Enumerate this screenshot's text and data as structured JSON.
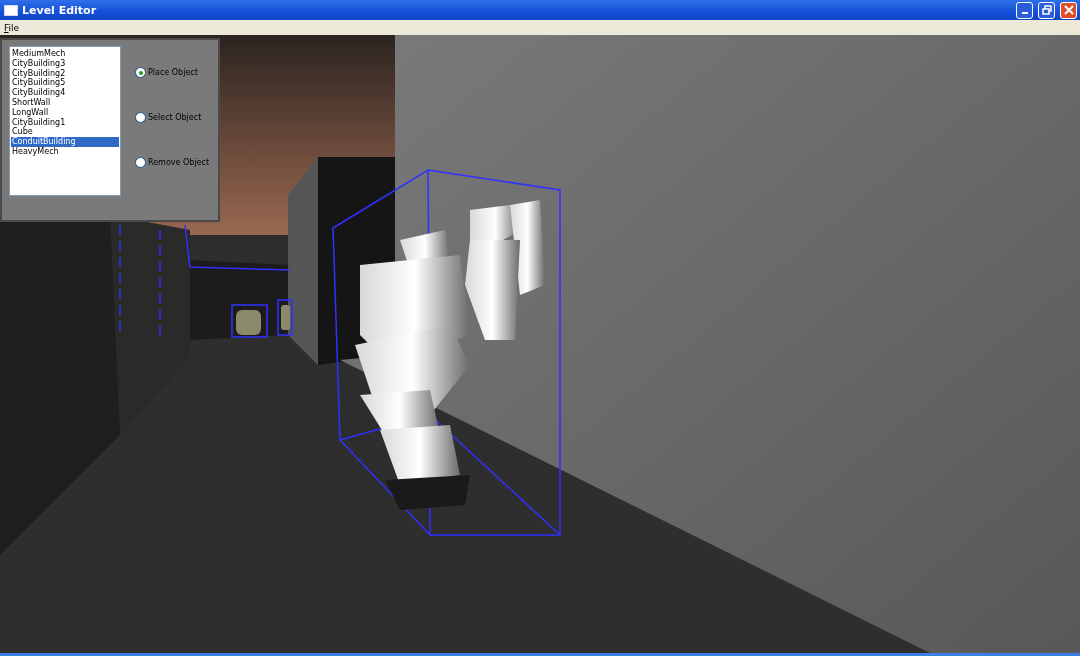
{
  "window": {
    "title": "Level Editor"
  },
  "menu": [
    {
      "label": "File"
    }
  ],
  "object_list": [
    {
      "label": "MediumMech",
      "selected": false
    },
    {
      "label": "CityBuilding3",
      "selected": false
    },
    {
      "label": "CityBuilding2",
      "selected": false
    },
    {
      "label": "CityBuilding5",
      "selected": false
    },
    {
      "label": "CityBuilding4",
      "selected": false
    },
    {
      "label": "ShortWall",
      "selected": false
    },
    {
      "label": "LongWall",
      "selected": false
    },
    {
      "label": "CityBuilding1",
      "selected": false
    },
    {
      "label": "Cube",
      "selected": false
    },
    {
      "label": "ConduitBuilding",
      "selected": true
    },
    {
      "label": "HeavyMech",
      "selected": false
    }
  ],
  "modes": [
    {
      "label": "Place Object",
      "selected": true
    },
    {
      "label": "Select Object",
      "selected": false
    },
    {
      "label": "Remove Object",
      "selected": false
    }
  ]
}
